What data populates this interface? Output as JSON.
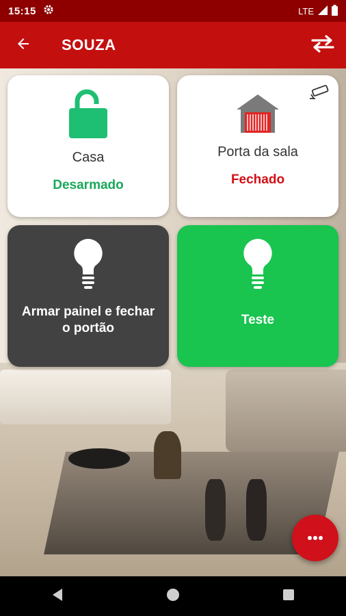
{
  "status_bar": {
    "time": "15:15",
    "network": "LTE",
    "settings_icon": "gear-icon",
    "signal_icon": "signal-icon",
    "battery_icon": "battery-icon"
  },
  "app_bar": {
    "title": "SOUZA",
    "back_icon": "arrow-left-icon",
    "swap_icon": "swap-icon"
  },
  "tiles": [
    {
      "name": "Casa",
      "status": "Desarmado",
      "status_color": "#19a85a",
      "icon": "lock-open-icon",
      "icon_color": "#1fbf73"
    },
    {
      "name": "Porta da sala",
      "status": "Fechado",
      "status_color": "#d10f15",
      "icon": "garage-icon",
      "extra_icon": "camera-icon"
    },
    {
      "label": "Armar painel e fechar o portão",
      "icon": "lightbulb-icon",
      "background": "#424242"
    },
    {
      "label": "Teste",
      "icon": "lightbulb-icon",
      "background": "#19c44f"
    }
  ],
  "fab": {
    "icon": "more-horizontal-icon",
    "color": "#d0101a"
  },
  "nav": {
    "back_icon": "nav-back-icon",
    "home_icon": "nav-home-icon",
    "recents_icon": "nav-recents-icon"
  },
  "colors": {
    "status_bar": "#8e0000",
    "app_bar": "#c40f0f"
  }
}
